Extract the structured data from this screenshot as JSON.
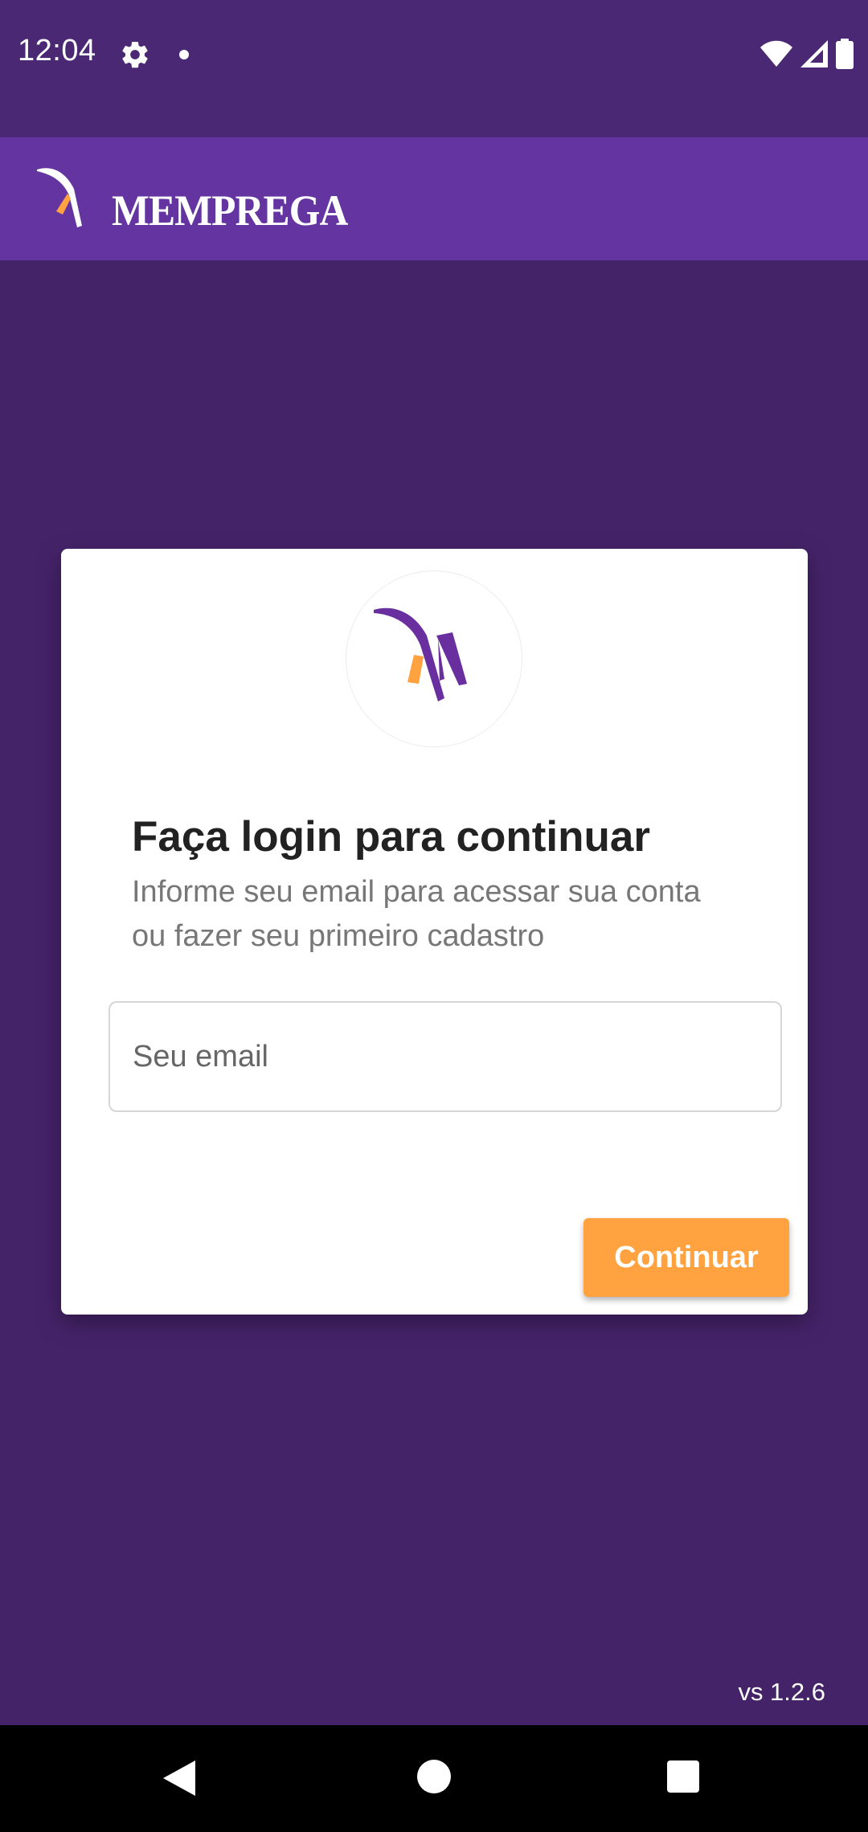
{
  "status_bar": {
    "time": "12:04",
    "icons": [
      "gear-icon",
      "notification-dot-icon",
      "wifi-icon",
      "signal-icon",
      "battery-icon"
    ]
  },
  "app_bar": {
    "brand": "MEMPREGA"
  },
  "login_card": {
    "title": "Faça login para continuar",
    "subtitle": "Informe seu email para acessar sua conta ou fazer seu primeiro cadastro",
    "email_placeholder": "Seu email",
    "email_value": "",
    "continue_label": "Continuar"
  },
  "footer": {
    "version": "vs 1.2.6"
  },
  "nav_bar": {
    "icons": [
      "back-icon",
      "home-icon",
      "recents-icon"
    ]
  },
  "colors": {
    "background": "#452369",
    "status_bar": "#4a2873",
    "app_bar": "#6435a0",
    "accent_orange": "#ffa23f",
    "brand_purple": "#6a2f9e"
  }
}
